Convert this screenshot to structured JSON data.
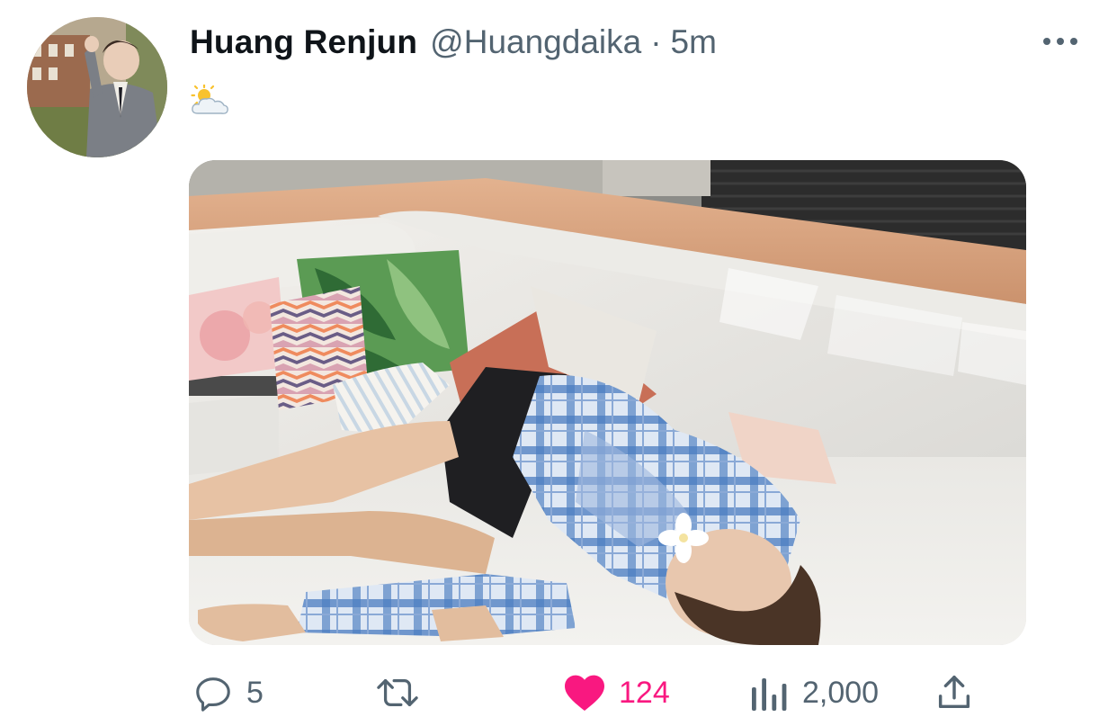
{
  "tweet": {
    "author": {
      "display_name": "Huang Renjun",
      "handle": "@Huangdaika"
    },
    "separator": "·",
    "timestamp": "5m",
    "text": "🌥",
    "media": {
      "icon": "photo-of-person-lying-on-outdoor-sofa"
    }
  },
  "actions": {
    "reply": {
      "icon": "reply-icon",
      "count": "5"
    },
    "retweet": {
      "icon": "retweet-icon",
      "count": ""
    },
    "like": {
      "icon": "heart-icon",
      "count": "124",
      "liked": true,
      "color": "#f91880"
    },
    "views": {
      "icon": "views-icon",
      "count": "2,000"
    },
    "share": {
      "icon": "share-icon"
    }
  },
  "colors": {
    "text_primary": "#0f1419",
    "text_secondary": "#536471",
    "like_active": "#f91880"
  }
}
